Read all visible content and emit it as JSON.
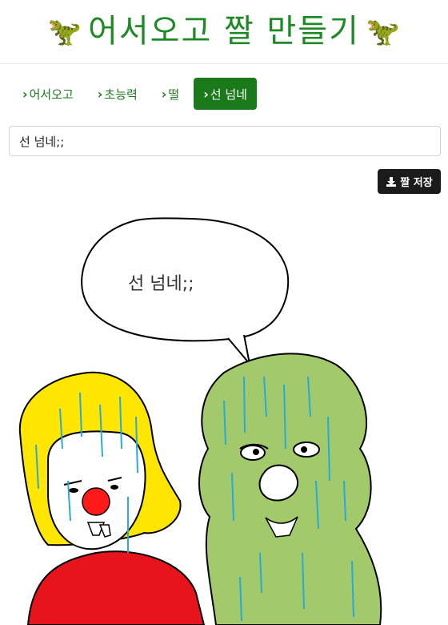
{
  "header": {
    "title": "어서오고 짤 만들기",
    "dino_left": "🦖",
    "dino_right": "🦖"
  },
  "tabs": [
    {
      "label": "어서오고",
      "active": false
    },
    {
      "label": "초능력",
      "active": false
    },
    {
      "label": "떨",
      "active": false
    },
    {
      "label": "선 넘네",
      "active": true
    }
  ],
  "input": {
    "value": "선 넘네;;"
  },
  "save_button": {
    "label": "짤 저장",
    "icon": "download-icon"
  },
  "comic": {
    "speech": "선 넘네;;",
    "colors": {
      "hair": "#ffe600",
      "nose": "#ff1a1a",
      "shirt": "#e8141c",
      "green_character": "#a2c96a",
      "drip": "#2aa8e0"
    }
  }
}
